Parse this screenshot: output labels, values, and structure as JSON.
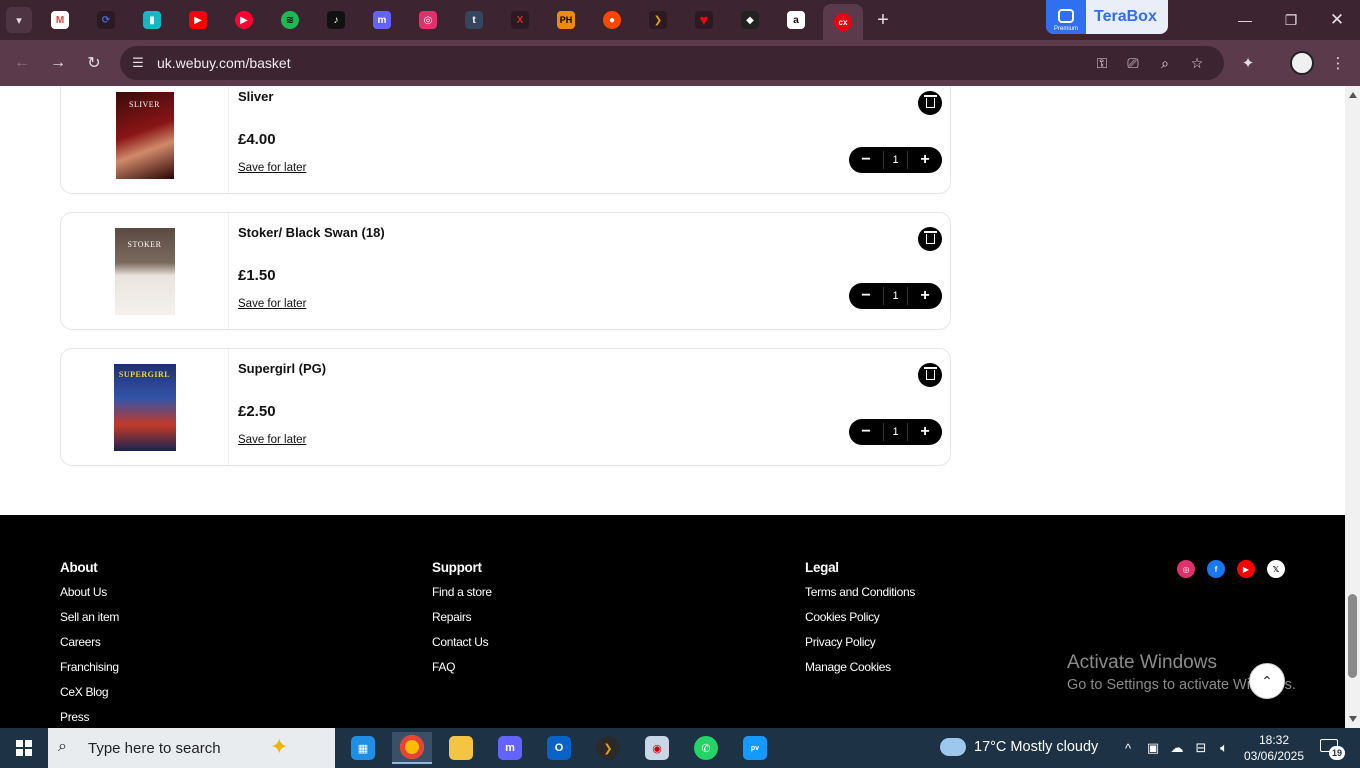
{
  "browser": {
    "url": "uk.webuy.com/basket",
    "pinned_tabs": [
      {
        "name": "gmail",
        "glyph": "M",
        "color": "#ea4335"
      },
      {
        "name": "generic",
        "glyph": "⟳",
        "color": "#4a6ee0"
      },
      {
        "name": "teal",
        "glyph": "▮",
        "color": "#14b8c4"
      },
      {
        "name": "youtube",
        "glyph": "▶",
        "color": "#ff0000"
      },
      {
        "name": "youtube-music",
        "glyph": "▶",
        "color": "#ff0033"
      },
      {
        "name": "spotify",
        "glyph": "≋",
        "color": "#1db954"
      },
      {
        "name": "tiktok",
        "glyph": "♪",
        "color": "#111111"
      },
      {
        "name": "mastodon",
        "glyph": "m",
        "color": "#6364ff"
      },
      {
        "name": "instagram",
        "glyph": "◎",
        "color": "#e1306c"
      },
      {
        "name": "tumblr",
        "glyph": "t",
        "color": "#35465c"
      },
      {
        "name": "x-red",
        "glyph": "X",
        "color": "#d62b1f"
      },
      {
        "name": "ph",
        "glyph": "PH",
        "color": "#f08a0c"
      },
      {
        "name": "reddit",
        "glyph": "●",
        "color": "#ff4500"
      },
      {
        "name": "plex",
        "glyph": "❯",
        "color": "#e5a00d"
      },
      {
        "name": "heart",
        "glyph": "♥",
        "color": "#e50914"
      },
      {
        "name": "cube",
        "glyph": "◆",
        "color": "#222222"
      },
      {
        "name": "amazon",
        "glyph": "a",
        "color": "#ffffff"
      }
    ],
    "terabox": {
      "brand": "TeraBox",
      "tier": "Premium"
    }
  },
  "basket": {
    "items": [
      {
        "title": "Sliver",
        "price": "£4.00",
        "save_label": "Save for later",
        "quantity": "1",
        "cover_text": "SLIVER"
      },
      {
        "title": "Stoker/ Black Swan (18)",
        "price": "£1.50",
        "save_label": "Save for later",
        "quantity": "1",
        "cover_text": "STOKER"
      },
      {
        "title": "Supergirl (PG)",
        "price": "£2.50",
        "save_label": "Save for later",
        "quantity": "1",
        "cover_text": "SUPERGIRL"
      }
    ]
  },
  "footer": {
    "about": {
      "heading": "About",
      "links": [
        "About Us",
        "Sell an item",
        "Careers",
        "Franchising",
        "CeX Blog",
        "Press"
      ]
    },
    "support": {
      "heading": "Support",
      "links": [
        "Find a store",
        "Repairs",
        "Contact Us",
        "FAQ"
      ]
    },
    "legal": {
      "heading": "Legal",
      "links": [
        "Terms and Conditions",
        "Cookies Policy",
        "Privacy Policy",
        "Manage Cookies"
      ]
    },
    "social": [
      {
        "name": "instagram",
        "color": "#e1306c"
      },
      {
        "name": "facebook",
        "color": "#1877f2"
      },
      {
        "name": "youtube",
        "color": "#ff0000"
      },
      {
        "name": "x",
        "color": "#ffffff"
      }
    ]
  },
  "watermark": {
    "line1": "Activate Windows",
    "line2": "Go to Settings to activate Windows."
  },
  "taskbar": {
    "search_placeholder": "Type here to search",
    "weather": "17°C  Mostly cloudy",
    "time": "18:32",
    "date": "03/06/2025",
    "notifications": "19"
  }
}
